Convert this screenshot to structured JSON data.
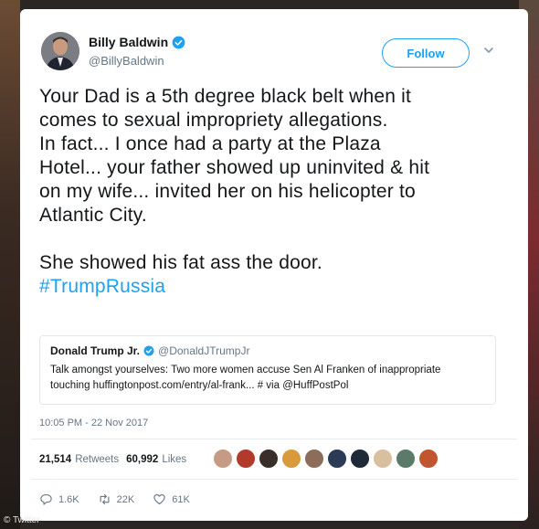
{
  "author": {
    "name": "Billy Baldwin",
    "handle": "@BillyBaldwin"
  },
  "follow_label": "Follow",
  "tweet_lines": [
    "Your Dad is a 5th degree black belt when it",
    "comes to sexual impropriety allegations.",
    "In fact... I once had a party at the Plaza",
    "Hotel... your father showed up uninvited & hit",
    "on my wife... invited her on his helicopter to",
    "Atlantic City.",
    "",
    "She showed his fat ass the door."
  ],
  "hashtag": "#TrumpRussia",
  "quoted_tweet": {
    "name": "Donald Trump Jr.",
    "handle": "@DonaldJTrumpJr",
    "line1": "Talk amongst yourselves: Two more women accuse Sen Al Franken of inappropriate",
    "line2": "touching huffingtonpost.com/entry/al-frank... # via @HuffPostPol"
  },
  "timestamp": "10:05 PM - 22 Nov 2017",
  "stats": {
    "retweets_count": "21,514",
    "retweets_label": "Retweets",
    "likes_count": "60,992",
    "likes_label": "Likes"
  },
  "actions": {
    "replies": "1.6K",
    "retweets": "22K",
    "likes": "61K"
  },
  "liker_colors": [
    "#c79a86",
    "#b23a2a",
    "#3a2f28",
    "#d99a3c",
    "#8c6d5a",
    "#2b3a55",
    "#1e2a38",
    "#d8c09e",
    "#5b7a6a",
    "#c0562f"
  ],
  "colors": {
    "accent": "#1da1f2",
    "text": "#14171a",
    "secondary": "#657786"
  },
  "watermark": "© Twitter"
}
